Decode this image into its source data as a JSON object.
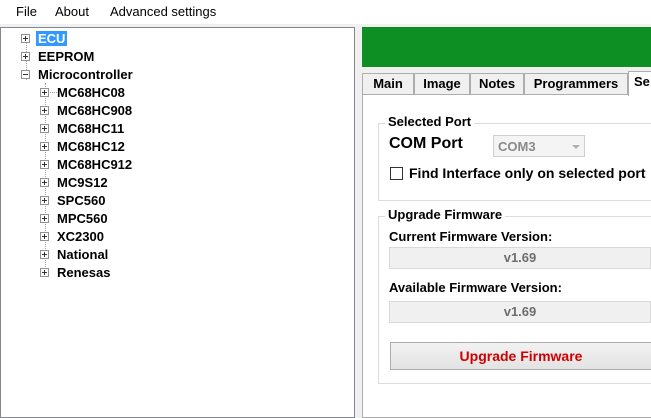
{
  "menu": {
    "file": "File",
    "about": "About",
    "advanced": "Advanced settings"
  },
  "tree": {
    "ecu": "ECU",
    "eeprom": "EEPROM",
    "microcontroller": "Microcontroller",
    "children": [
      "MC68HC08",
      "MC68HC908",
      "MC68HC11",
      "MC68HC12",
      "MC68HC912",
      "MC9S12",
      "SPC560",
      "MPC560",
      "XC2300",
      "National",
      "Renesas"
    ]
  },
  "colors": {
    "status_bar": "#0d8f24",
    "selection": "#3399ff",
    "upgrade_text": "#d00000"
  },
  "tabs": {
    "main": "Main",
    "image": "Image",
    "notes": "Notes",
    "programmers": "Programmers",
    "settings": "Se"
  },
  "selected_port": {
    "title": "Selected Port",
    "com_label": "COM Port",
    "com_value": "COM3",
    "find_label": "Find Interface only on selected port"
  },
  "upgrade": {
    "title": "Upgrade Firmware",
    "current_label": "Current Firmware Version:",
    "current_value": "v1.69",
    "available_label": "Available Firmware Version:",
    "available_value": "v1.69",
    "button": "Upgrade Firmware"
  }
}
